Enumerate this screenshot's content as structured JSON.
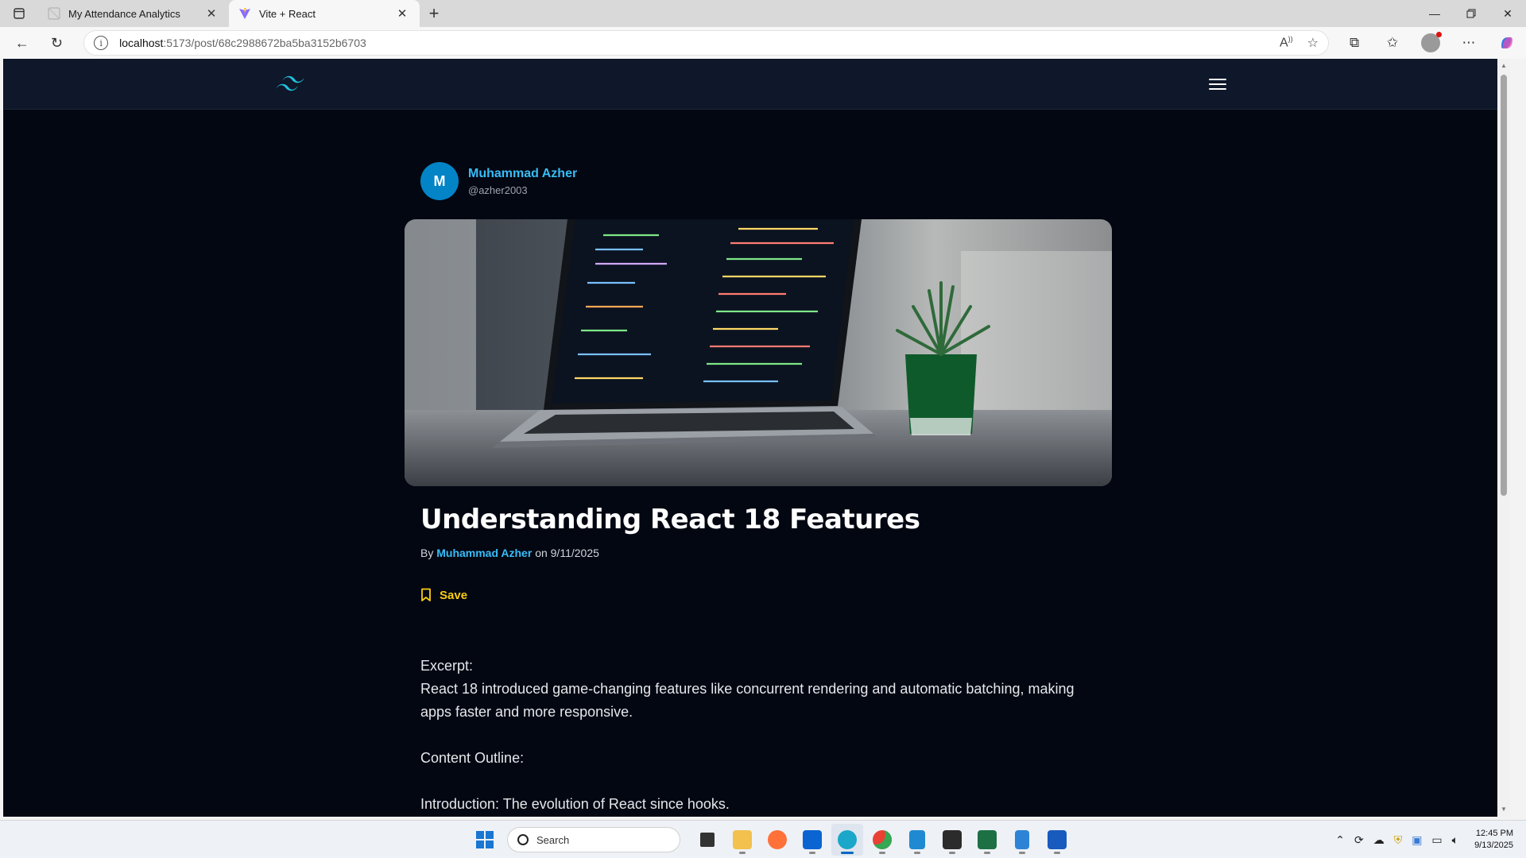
{
  "browser": {
    "tabs": [
      {
        "title": "My Attendance Analytics",
        "active": false
      },
      {
        "title": "Vite + React",
        "active": true
      }
    ],
    "url_host": "localhost",
    "url_path": ":5173/post/68c2988672ba5ba3152b6703"
  },
  "post": {
    "author": {
      "initial": "M",
      "name": "Muhammad Azher",
      "handle": "@azher2003"
    },
    "title": "Understanding React 18 Features",
    "byline_prefix": "By",
    "byline_author": "Muhammad Azher",
    "byline_date": "on 9/11/2025",
    "save_label": "Save",
    "paragraphs": [
      "Excerpt:",
      "React 18 introduced game-changing features like concurrent rendering and automatic batching, making apps faster and more responsive.",
      "Content Outline:",
      "Introduction: The evolution of React since hooks."
    ]
  },
  "taskbar": {
    "search_placeholder": "Search",
    "time": "12:45 PM",
    "date": "9/13/2025"
  },
  "colors": {
    "page_bg": "#030712",
    "header_bg": "#0f172a",
    "accent_link": "#38bdf8",
    "save_yellow": "#facc15",
    "avatar_bg": "#0284c7"
  }
}
